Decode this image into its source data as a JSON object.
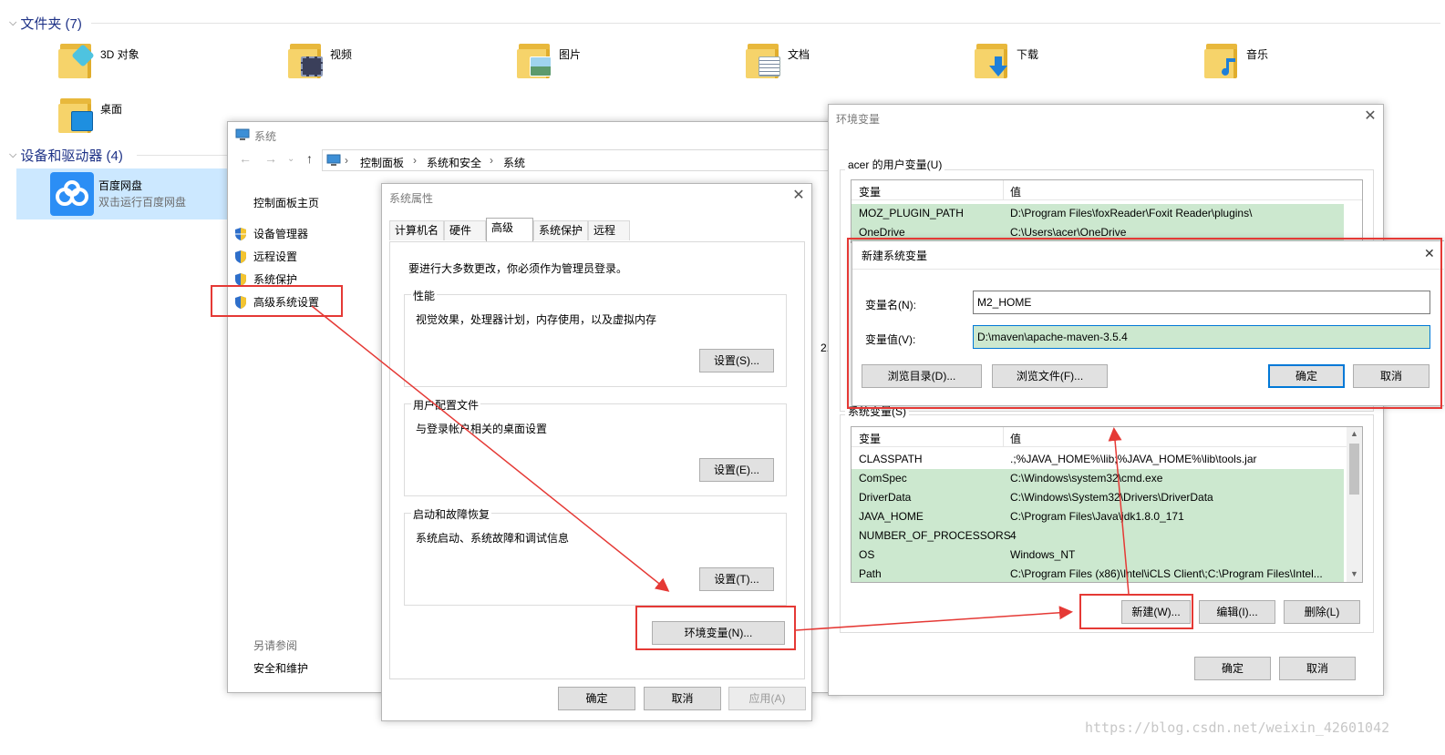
{
  "explorer": {
    "folders_header": "文件夹 (7)",
    "folders": [
      {
        "label": "3D 对象",
        "icon": "folder-3d-icon"
      },
      {
        "label": "视频",
        "icon": "folder-video-icon"
      },
      {
        "label": "图片",
        "icon": "folder-pictures-icon"
      },
      {
        "label": "文档",
        "icon": "folder-documents-icon"
      },
      {
        "label": "下载",
        "icon": "folder-downloads-icon"
      },
      {
        "label": "音乐",
        "icon": "folder-music-icon"
      },
      {
        "label": "桌面",
        "icon": "folder-desktop-icon"
      }
    ],
    "drives_header": "设备和驱动器 (4)",
    "drive": {
      "name": "百度网盘",
      "subtitle": "双击运行百度网盘",
      "icon": "baidu-netdisk-icon"
    }
  },
  "system_window": {
    "title": "系统",
    "breadcrumb": [
      "控制面板",
      "系统和安全",
      "系统"
    ],
    "home_link": "控制面板主页",
    "links": [
      "设备管理器",
      "远程设置",
      "系统保护",
      "高级系统设置"
    ],
    "see_also_title": "另请参阅",
    "see_also_link": "安全和维护",
    "partial_text": "2."
  },
  "sys_props": {
    "title": "系统属性",
    "tabs": [
      "计算机名",
      "硬件",
      "高级",
      "系统保护",
      "远程"
    ],
    "active_tab": "高级",
    "admin_note": "要进行大多数更改，你必须作为管理员登录。",
    "groups": [
      {
        "title": "性能",
        "desc": "视觉效果，处理器计划，内存使用，以及虚拟内存",
        "button": "设置(S)..."
      },
      {
        "title": "用户配置文件",
        "desc": "与登录帐户相关的桌面设置",
        "button": "设置(E)..."
      },
      {
        "title": "启动和故障恢复",
        "desc": "系统启动、系统故障和调试信息",
        "button": "设置(T)..."
      }
    ],
    "env_button": "环境变量(N)...",
    "ok": "确定",
    "cancel": "取消",
    "apply": "应用(A)"
  },
  "env_window": {
    "title": "环境变量",
    "user_section": "acer 的用户变量(U)",
    "col_var": "变量",
    "col_val": "值",
    "user_vars": [
      {
        "name": "MOZ_PLUGIN_PATH",
        "value": "D:\\Program Files\\foxReader\\Foxit Reader\\plugins\\"
      },
      {
        "name": "OneDrive",
        "value": "C:\\Users\\acer\\OneDrive"
      }
    ],
    "system_section": "系统变量(S)",
    "system_vars": [
      {
        "name": "CLASSPATH",
        "value": ".;%JAVA_HOME%\\lib;%JAVA_HOME%\\lib\\tools.jar"
      },
      {
        "name": "ComSpec",
        "value": "C:\\Windows\\system32\\cmd.exe"
      },
      {
        "name": "DriverData",
        "value": "C:\\Windows\\System32\\Drivers\\DriverData"
      },
      {
        "name": "JAVA_HOME",
        "value": "C:\\Program Files\\Java\\jdk1.8.0_171"
      },
      {
        "name": "NUMBER_OF_PROCESSORS",
        "value": "4"
      },
      {
        "name": "OS",
        "value": "Windows_NT"
      },
      {
        "name": "Path",
        "value": "C:\\Program Files (x86)\\Intel\\iCLS Client\\;C:\\Program Files\\Intel..."
      }
    ],
    "new_button": "新建(W)...",
    "edit_button": "编辑(I)...",
    "delete_button": "删除(L)",
    "ok": "确定",
    "cancel": "取消"
  },
  "new_var_dialog": {
    "title": "新建系统变量",
    "name_label": "变量名(N):",
    "name_value": "M2_HOME",
    "value_label": "变量值(V):",
    "value_value": "D:\\maven\\apache-maven-3.5.4",
    "browse_dir": "浏览目录(D)...",
    "browse_file": "浏览文件(F)...",
    "ok": "确定",
    "cancel": "取消"
  },
  "watermark": "https://blog.csdn.net/weixin_42601042",
  "colors": {
    "annotation_red": "#e53935",
    "selection_green": "#cce8cf",
    "accent_blue": "#0078d7"
  }
}
